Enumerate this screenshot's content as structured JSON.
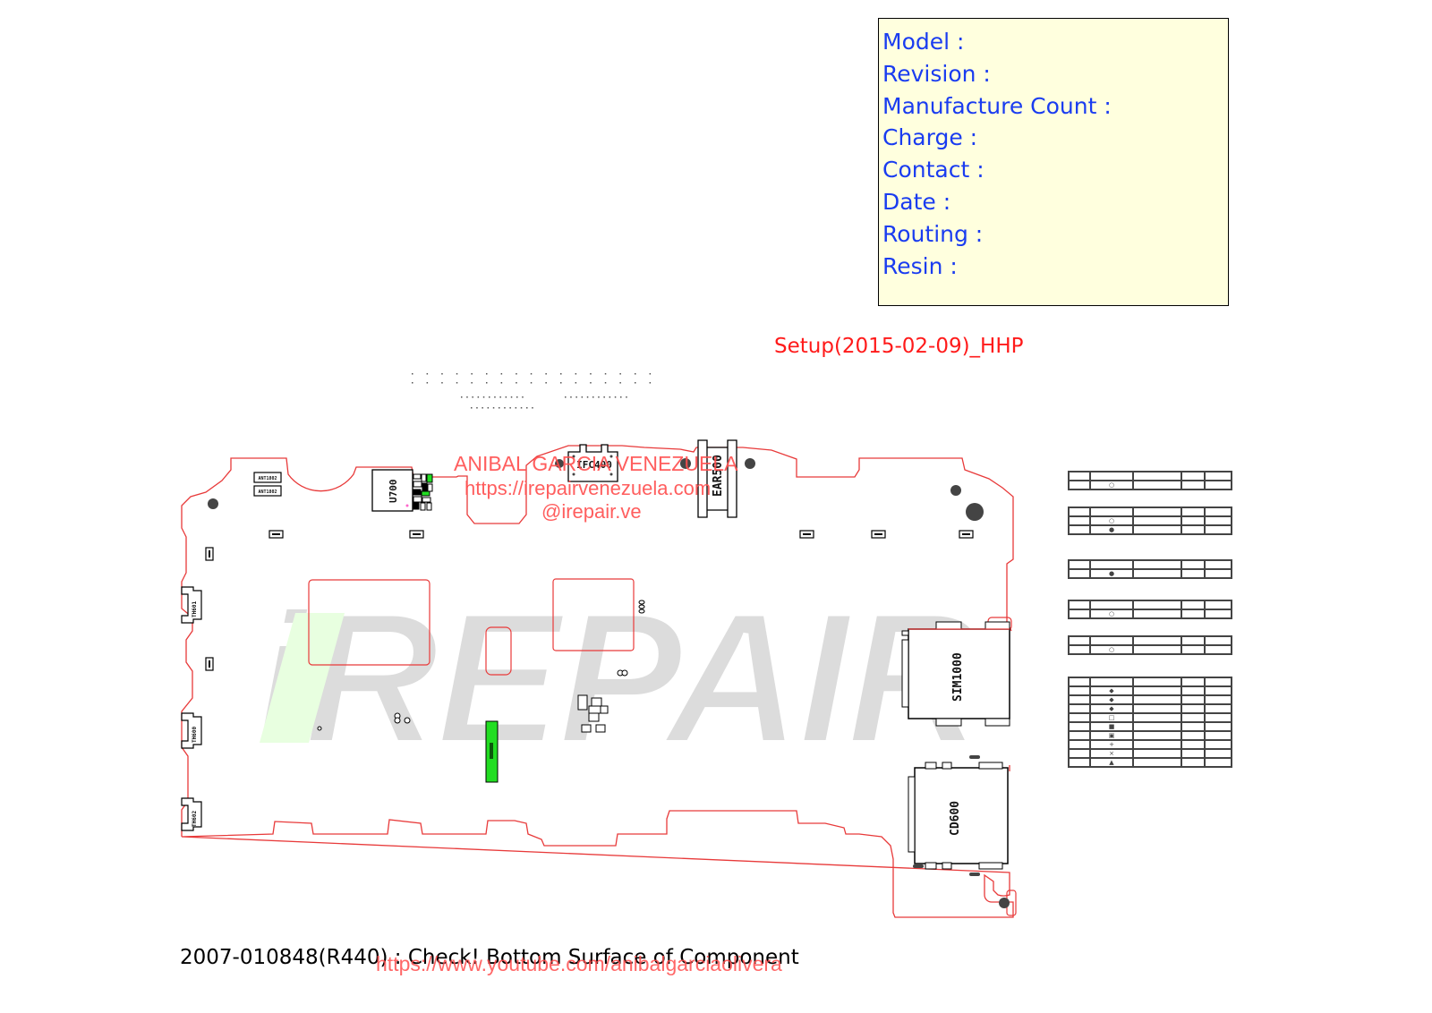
{
  "info_box": {
    "lines": [
      "Model :",
      "Revision :",
      "Manufacture Count :",
      "Charge :",
      "Contact :",
      "Date :",
      "Routing :",
      "Resin :"
    ],
    "background": "#ffffde",
    "text_color": "#1a3cf0"
  },
  "setup_label": "Setup(2015-02-09)_HHP",
  "watermark": {
    "name": "ANIBAL GARCIA VENEZUELA",
    "site": "https://irepairvenezuela.com",
    "handle": "@irepair.ve",
    "logo_text": "iREPAIR",
    "youtube": "https://www.youtube.com/anibalgarciaolivera"
  },
  "footer": {
    "part_number": "2007-010848(R440)",
    "note": " :  Check!  Bottom Surface of Component"
  },
  "components": {
    "u700": "U700",
    "ifc400": "IFC400",
    "ear500": "EAR500",
    "sim1000": "SIM1000",
    "cd600": "CD600",
    "ant1": "ANT1802",
    "ant2": "ANT1802",
    "left1": "TH601",
    "left2": "TH600",
    "left3": "TH602"
  },
  "legend_tables": [
    {
      "rows": 2,
      "symbols": [
        "",
        "○"
      ]
    },
    {
      "rows": 3,
      "symbols": [
        "",
        "○",
        "●"
      ]
    },
    {
      "rows": 2,
      "symbols": [
        "",
        "●"
      ]
    },
    {
      "rows": 2,
      "symbols": [
        "",
        "○"
      ]
    },
    {
      "rows": 2,
      "symbols": [
        "",
        "○"
      ]
    },
    {
      "rows": 10,
      "symbols": [
        "",
        "◆",
        "◆",
        "◆",
        "□",
        "■",
        "▣",
        "+",
        "×",
        "▲"
      ]
    }
  ],
  "colors": {
    "outline": "#e83a3a",
    "highlight": "#22dd22",
    "blue_text": "#1a3cf0",
    "red_text": "#ff1a1a"
  }
}
